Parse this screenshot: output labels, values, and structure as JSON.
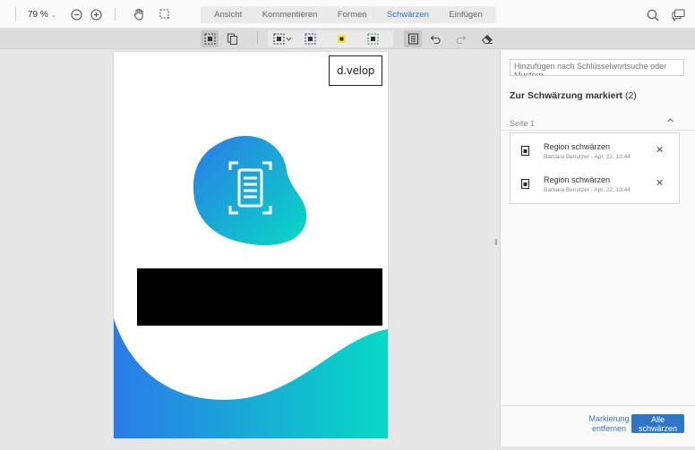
{
  "toolbar": {
    "zoom_value": "79 %",
    "zoom_chevron": "⌄",
    "icons": [
      "zoom-out-icon",
      "zoom-in-icon",
      "pan-hand-icon",
      "select-area-icon",
      "search-icon",
      "comments-icon"
    ]
  },
  "tabs": [
    {
      "label": "Ansicht",
      "active": false
    },
    {
      "label": "Kommentieren",
      "active": false
    },
    {
      "label": "Formen",
      "active": false
    },
    {
      "label": "Schwärzen",
      "active": true
    },
    {
      "label": "Einfügen",
      "active": false
    }
  ],
  "subtoolbar": {
    "icons": [
      "redact-region-icon",
      "redact-pages-icon",
      "redact-select-icon",
      "redact-text-icon",
      "redact-highlight-icon",
      "redact-area-icon",
      "redaction-panel-icon",
      "undo-icon",
      "redo-icon",
      "eraser-icon"
    ]
  },
  "document": {
    "logo_text": "d.velop",
    "colors": {
      "gradient_start": "#2b7be8",
      "gradient_end": "#07d9c4",
      "redaction": "#000000"
    }
  },
  "panel": {
    "search_placeholder": "Hinzufügen nach Schlüsselwortsuche oder Mustern",
    "title": "Zur Schwärzung markiert",
    "count": "(2)",
    "page_label": "Seite 1",
    "marks": [
      {
        "title": "Region schwärzen",
        "subtitle": "Barbara Benutzer - Apr. 22, 13:44"
      },
      {
        "title": "Region schwärzen",
        "subtitle": "Barbara Benutzer - Apr. 22, 13:44"
      }
    ],
    "unmark_label": "Markierung entfernen",
    "apply_label": "Alle schwärzen"
  },
  "colors": {
    "accent": "#2f77c6"
  }
}
